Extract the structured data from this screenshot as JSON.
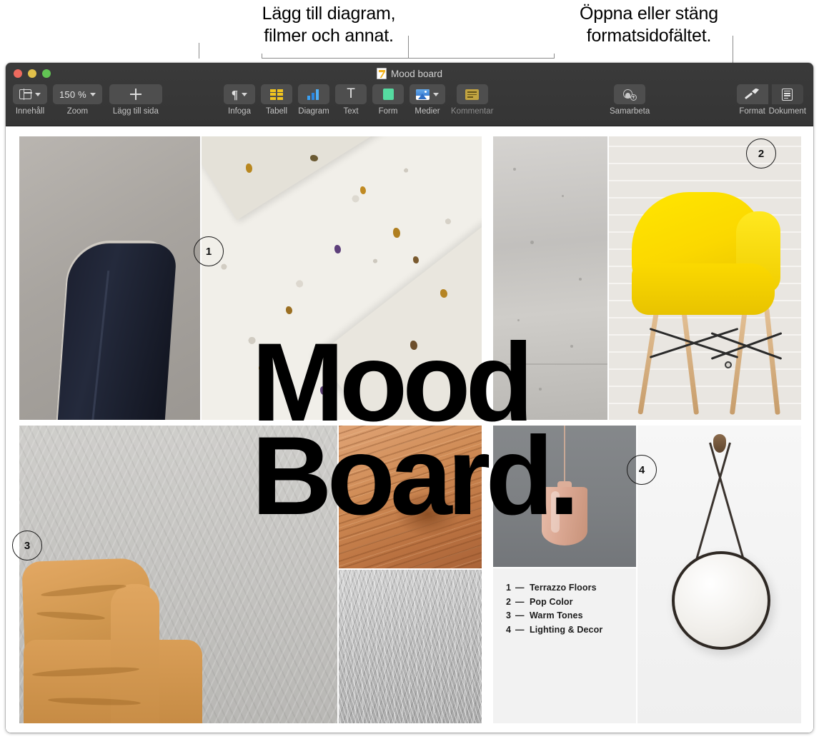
{
  "annotations": {
    "left_callout": "Lägg till diagram,\nfilmer och annat.",
    "right_callout": "Öppna eller stäng\nformatsidofältet."
  },
  "window": {
    "title": "Mood board",
    "doc_icon": "keynote-document-icon",
    "traffic_lights": {
      "close": "close-window-button",
      "minimize": "minimize-window-button",
      "maximize": "maximize-window-button"
    }
  },
  "toolbar": {
    "left_group": [
      {
        "label": "Innehåll",
        "icon": "sidebar-panel-icon",
        "has_chevron": true
      },
      {
        "label": "Zoom",
        "value": "150 %",
        "icon": "zoom-value",
        "has_chevron": true
      },
      {
        "label": "Lägg till sida",
        "icon": "plus-icon",
        "has_chevron": false
      }
    ],
    "insert_group": [
      {
        "label": "Infoga",
        "icon": "pilcrow-icon",
        "has_chevron": true
      },
      {
        "label": "Tabell",
        "icon": "table-icon",
        "has_chevron": false
      },
      {
        "label": "Diagram",
        "icon": "bar-chart-icon",
        "has_chevron": false
      },
      {
        "label": "Text",
        "icon": "text-t-icon",
        "has_chevron": false
      },
      {
        "label": "Form",
        "icon": "shape-square-icon",
        "has_chevron": false
      },
      {
        "label": "Medier",
        "icon": "media-photo-icon",
        "has_chevron": true
      },
      {
        "label": "Kommentar",
        "icon": "comment-icon",
        "has_chevron": false,
        "disabled": true
      }
    ],
    "collaborate": {
      "label": "Samarbeta",
      "icon": "add-person-icon"
    },
    "right_group": [
      {
        "label": "Format",
        "icon": "format-brush-icon",
        "active": true
      },
      {
        "label": "Dokument",
        "icon": "document-icon",
        "active": false
      }
    ]
  },
  "document": {
    "headline_line1": "Mood",
    "headline_line2": "Board.",
    "legend": [
      {
        "num": "1",
        "dash": "—",
        "label": "Terrazzo Floors"
      },
      {
        "num": "2",
        "dash": "—",
        "label": "Pop Color"
      },
      {
        "num": "3",
        "dash": "—",
        "label": "Warm Tones"
      },
      {
        "num": "4",
        "dash": "—",
        "label": "Lighting & Decor"
      }
    ],
    "bubbles": [
      {
        "num": "1",
        "refers_to": "Terrazzo Floors"
      },
      {
        "num": "2",
        "refers_to": "Pop Color"
      },
      {
        "num": "3",
        "refers_to": "Warm Tones"
      },
      {
        "num": "4",
        "refers_to": "Lighting & Decor"
      }
    ],
    "images": [
      {
        "name": "dark-leather-chair-photo"
      },
      {
        "name": "terrazzo-slab-photo"
      },
      {
        "name": "concrete-wall-photo"
      },
      {
        "name": "yellow-eames-chair-photo"
      },
      {
        "name": "tan-leather-sofa-photo"
      },
      {
        "name": "wood-grain-photo"
      },
      {
        "name": "grey-fur-texture-photo"
      },
      {
        "name": "pink-pendant-lamp-photo"
      },
      {
        "name": "round-hanging-mirror-photo"
      }
    ]
  },
  "colors": {
    "toolbar_bg": "#383838",
    "toolbar_button": "#4e4e4e",
    "accent_yellow": "#f0c420",
    "accent_blue": "#2e9bf0",
    "accent_green": "#55dba0",
    "pop_color": "#ffe600",
    "warm_tone": "#d0974f"
  }
}
